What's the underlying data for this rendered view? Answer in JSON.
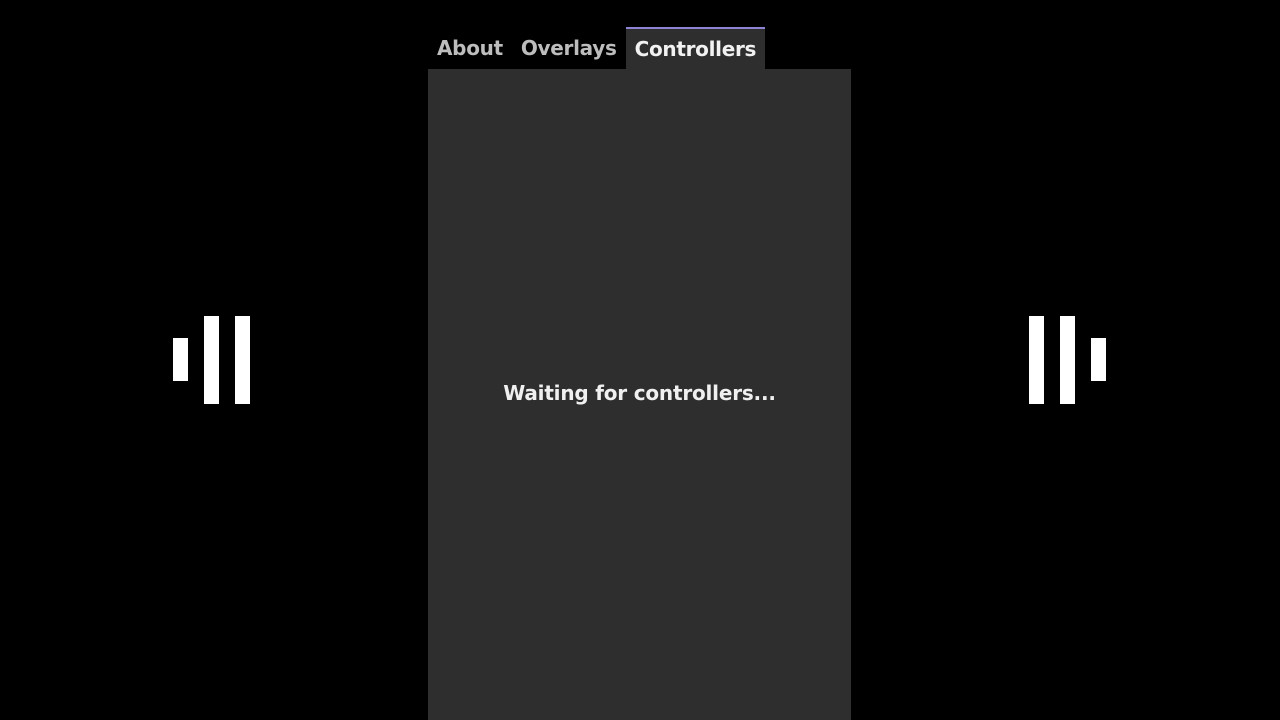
{
  "tabs": [
    {
      "label": "About",
      "active": false
    },
    {
      "label": "Overlays",
      "active": false
    },
    {
      "label": "Controllers",
      "active": true
    }
  ],
  "panel": {
    "message": "Waiting for controllers..."
  },
  "colors": {
    "background": "#000000",
    "panel": "#2e2e2e",
    "active_tab_accent": "#8e84d6",
    "inactive_tab_text": "#bdbdbd",
    "active_tab_text": "#f2f2f2"
  },
  "icons": {
    "left": "left-audio-level-bars-icon",
    "right": "right-audio-level-bars-icon"
  }
}
